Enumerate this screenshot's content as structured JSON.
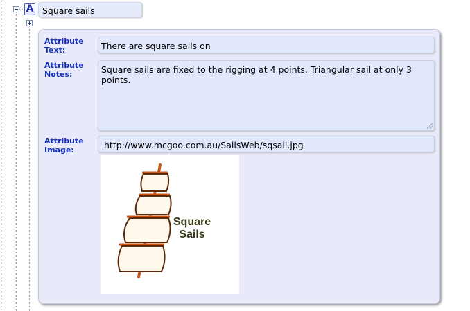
{
  "node": {
    "icon": "attribute-icon",
    "icon_glyph": "A",
    "title": "Square sails"
  },
  "attributes": {
    "text_label": "Attribute Text:",
    "text_value": "There are square sails on",
    "notes_label": "Attribute Notes:",
    "notes_value": "Square sails are fixed to the rigging at 4 points. Triangular sail at only 3 points.",
    "image_label": "Attribute Image:",
    "image_value": "http://www.mcgoo.com.au/SailsWeb/sqsail.jpg"
  },
  "image": {
    "caption_line1": "Square",
    "caption_line2": "Sails"
  },
  "colors": {
    "label_blue": "#1432b8",
    "panel_bg": "#e9eaf9",
    "field_bg": "#e2e8fc",
    "mast": "#c8561a",
    "sail_fill": "#fff8ec"
  }
}
